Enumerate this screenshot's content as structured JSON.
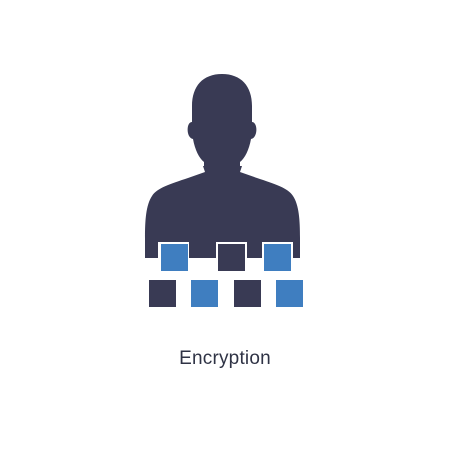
{
  "icon": {
    "name": "user-encryption-icon",
    "colors": {
      "primary": "#393a54",
      "accent": "#3f7ec0",
      "background": "#ffffff"
    },
    "blocks_top_row": [
      "accent",
      "primary",
      "accent"
    ],
    "blocks_bottom_row": [
      "primary",
      "accent",
      "primary",
      "accent"
    ]
  },
  "caption": {
    "text": "Encryption"
  }
}
